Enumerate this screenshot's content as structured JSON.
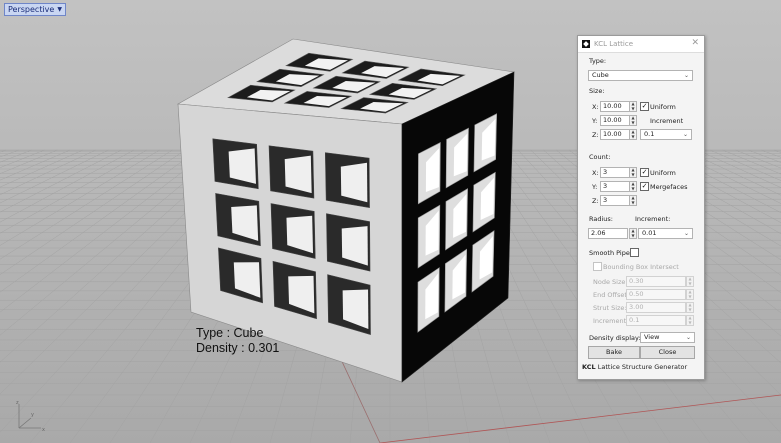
{
  "viewport": {
    "name": "Perspective"
  },
  "overlay": {
    "type_line": "Type : Cube",
    "density_line": "Density : 0.301"
  },
  "panel": {
    "title": "KCL Lattice",
    "type_label": "Type:",
    "type_value": "Cube",
    "size_label": "Size:",
    "size_x_label": "X:",
    "size_y_label": "Y:",
    "size_z_label": "Z:",
    "size_x": "10.00",
    "size_y": "10.00",
    "size_z": "10.00",
    "uniform_label": "Uniform",
    "increment_label": "Increment",
    "size_increment": "0.1",
    "count_label": "Count:",
    "count_x_label": "X:",
    "count_y_label": "Y:",
    "count_z_label": "Z:",
    "count_x": "3",
    "count_y": "3",
    "count_z": "3",
    "count_uniform_label": "Uniform",
    "mergefaces_label": "Mergefaces",
    "radius_label": "Radius:",
    "radius_increment_label": "Increment:",
    "radius": "2.06",
    "radius_increment": "0.01",
    "smooth_pipe_label": "Smooth Pipe",
    "bbox_label": "Bounding Box Intersect",
    "node_size_label": "Node Size:",
    "node_size": "0.30",
    "end_offset_label": "End Offset:",
    "end_offset": "0.50",
    "strut_size_label": "Strut Size:",
    "strut_size": "3.00",
    "increment2_label": "Increment:",
    "increment2": "0.1",
    "density_display_label": "Density display:",
    "density_display": "View",
    "bake_label": "Bake",
    "close_label": "Close",
    "footer_brand": "KCL",
    "footer_text": "Lattice Structure Generator"
  },
  "icons": {
    "logo": "kcl-logo-icon",
    "close": "close-icon",
    "dropdown": "chevron-down-icon",
    "spinner": "spinner-icon",
    "axis": "axis-gizmo-icon"
  }
}
